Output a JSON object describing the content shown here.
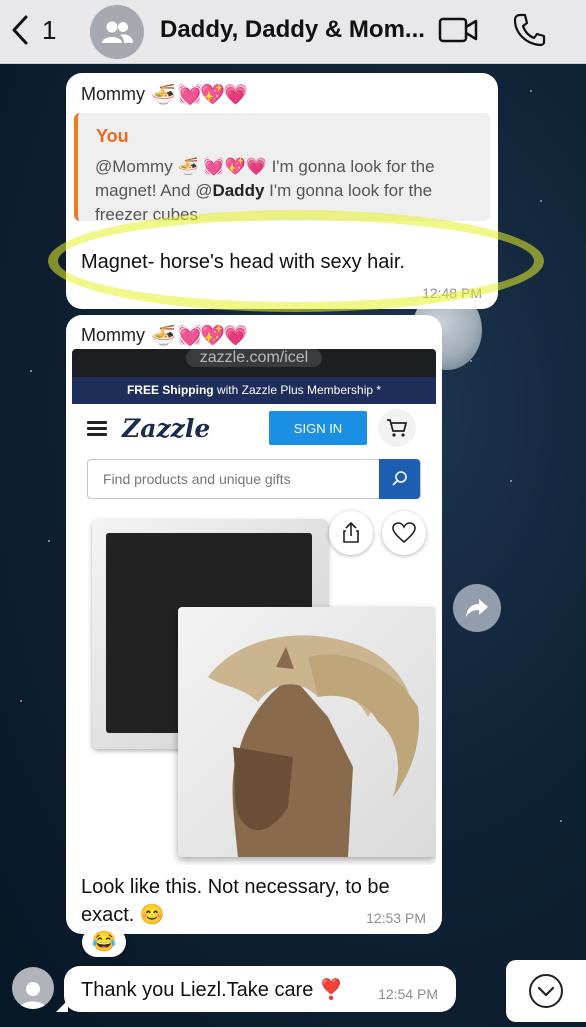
{
  "header": {
    "back_count": "1",
    "group_title": "Daddy, Daddy & Mom..."
  },
  "messages": [
    {
      "sender": "Mommy",
      "sender_emoji": "🍜 💓💖💗",
      "quote": {
        "author": "You",
        "mention_1": "@Mommy",
        "mention_1_emoji": "🍜 💓💖💗",
        "text_1": " I'm gonna look for the magnet! And ",
        "mention_2_prefix": "@",
        "mention_2": "Daddy",
        "text_2": " I'm gonna look for the freezer cubes"
      },
      "text": "Magnet- horse's head with sexy hair.",
      "time": "12:48 PM"
    },
    {
      "sender": "Mommy",
      "sender_emoji": "🍜 💓💖💗",
      "image": {
        "url_fragment": "zazzle.com/icel",
        "shipping_bold": "FREE Shipping",
        "shipping_rest": " with Zazzle Plus Membership *",
        "logo": "Zazzle",
        "signin_label": "SIGN IN",
        "search_placeholder": "Find products and unique gifts"
      },
      "text": "Look like this. Not necessary, to be exact. 😊",
      "time": "12:53 PM",
      "reaction": "😂"
    },
    {
      "text": "Thank you Liezl.Take care ❣️",
      "time": "12:54 PM"
    }
  ],
  "colors": {
    "header_bg": "#e8e8ea",
    "quote_accent": "#f07a22",
    "highlight": "#e6f028",
    "zazzle_blue": "#1a8fe3",
    "zazzle_navy": "#1e2d5a"
  },
  "icons": [
    "chevron-left-icon",
    "group-avatar-icon",
    "video-call-icon",
    "phone-icon",
    "hamburger-icon",
    "cart-icon",
    "search-icon",
    "share-icon",
    "heart-icon",
    "forward-icon",
    "person-icon",
    "chevron-down-icon"
  ]
}
